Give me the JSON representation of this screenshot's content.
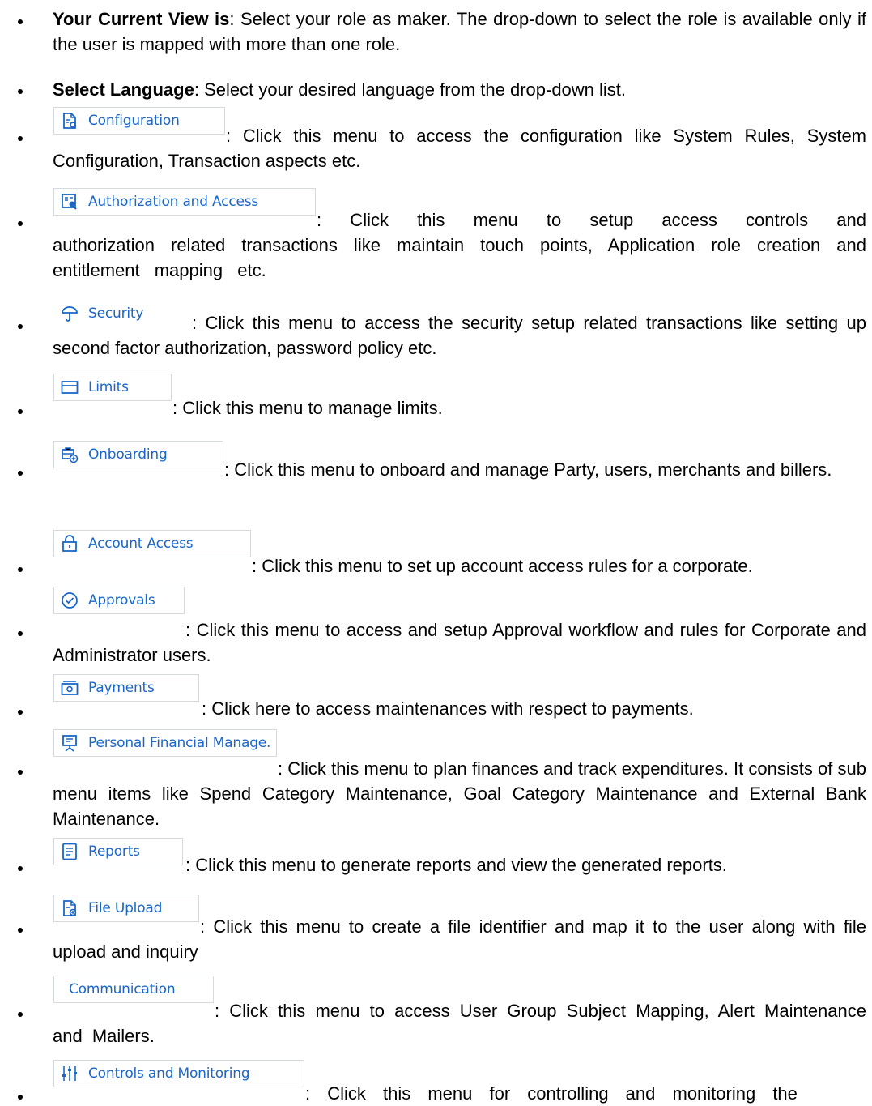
{
  "colors": {
    "accent": "#1a66c9",
    "chip_border": "#d6d9de"
  },
  "items": [
    {
      "term": "Your Current View is",
      "text": ": Select your role as maker. The drop-down to select the role is available only if the user is mapped with more than one role."
    },
    {
      "term": "Select Language",
      "text": ": Select your desired language from the drop-down list."
    },
    {
      "menu": "Configuration",
      "icon": "configuration-icon",
      "text": ": Click this menu to access the configuration like System Rules, System Configuration, Transaction aspects etc."
    },
    {
      "menu": "Authorization and Access",
      "icon": "authorization-icon",
      "text": ": Click this menu to setup access controls and authorization related transactions like maintain touch points, Application role creation and entitlement mapping etc."
    },
    {
      "menu": "Security",
      "icon": "security-umbrella-icon",
      "text": ": Click this menu to access the security setup related transactions like setting up second factor authorization, password policy etc."
    },
    {
      "menu": "Limits",
      "icon": "limits-card-icon",
      "text": ": Click this menu to manage limits."
    },
    {
      "menu": "Onboarding",
      "icon": "onboarding-icon",
      "text": ": Click this menu to onboard and manage Party, users, merchants and billers."
    },
    {
      "menu": "Account Access",
      "icon": "lock-icon",
      "text": ": Click this menu to set up account access rules for a corporate."
    },
    {
      "menu": "Approvals",
      "icon": "check-circle-icon",
      "text": ": Click this menu to access and setup  Approval workflow and rules  for Corporate and Administrator users."
    },
    {
      "menu": "Payments",
      "icon": "payments-icon",
      "text": ": Click here to access maintenances with respect to payments."
    },
    {
      "menu": "Personal Financial Manage.",
      "icon": "financial-board-icon",
      "text": ": Click this menu to plan finances and track expenditures. It consists of sub menu items like  Spend Category Maintenance, Goal Category Maintenance and External Bank Maintenance."
    },
    {
      "menu": "Reports",
      "icon": "reports-icon",
      "text": ": Click this menu to generate reports and view the generated reports."
    },
    {
      "menu": "File Upload",
      "icon": "file-upload-icon",
      "text": ": Click this menu to create a file identifier and map it to the user along with file upload and inquiry"
    },
    {
      "menu": "Communication",
      "icon": "",
      "text": ": Click this menu to access User Group Subject Mapping, Alert Maintenance and Mailers."
    },
    {
      "menu": "Controls and Monitoring",
      "icon": "sliders-icon",
      "text": ": Click this menu for controlling and monitoring the"
    }
  ]
}
